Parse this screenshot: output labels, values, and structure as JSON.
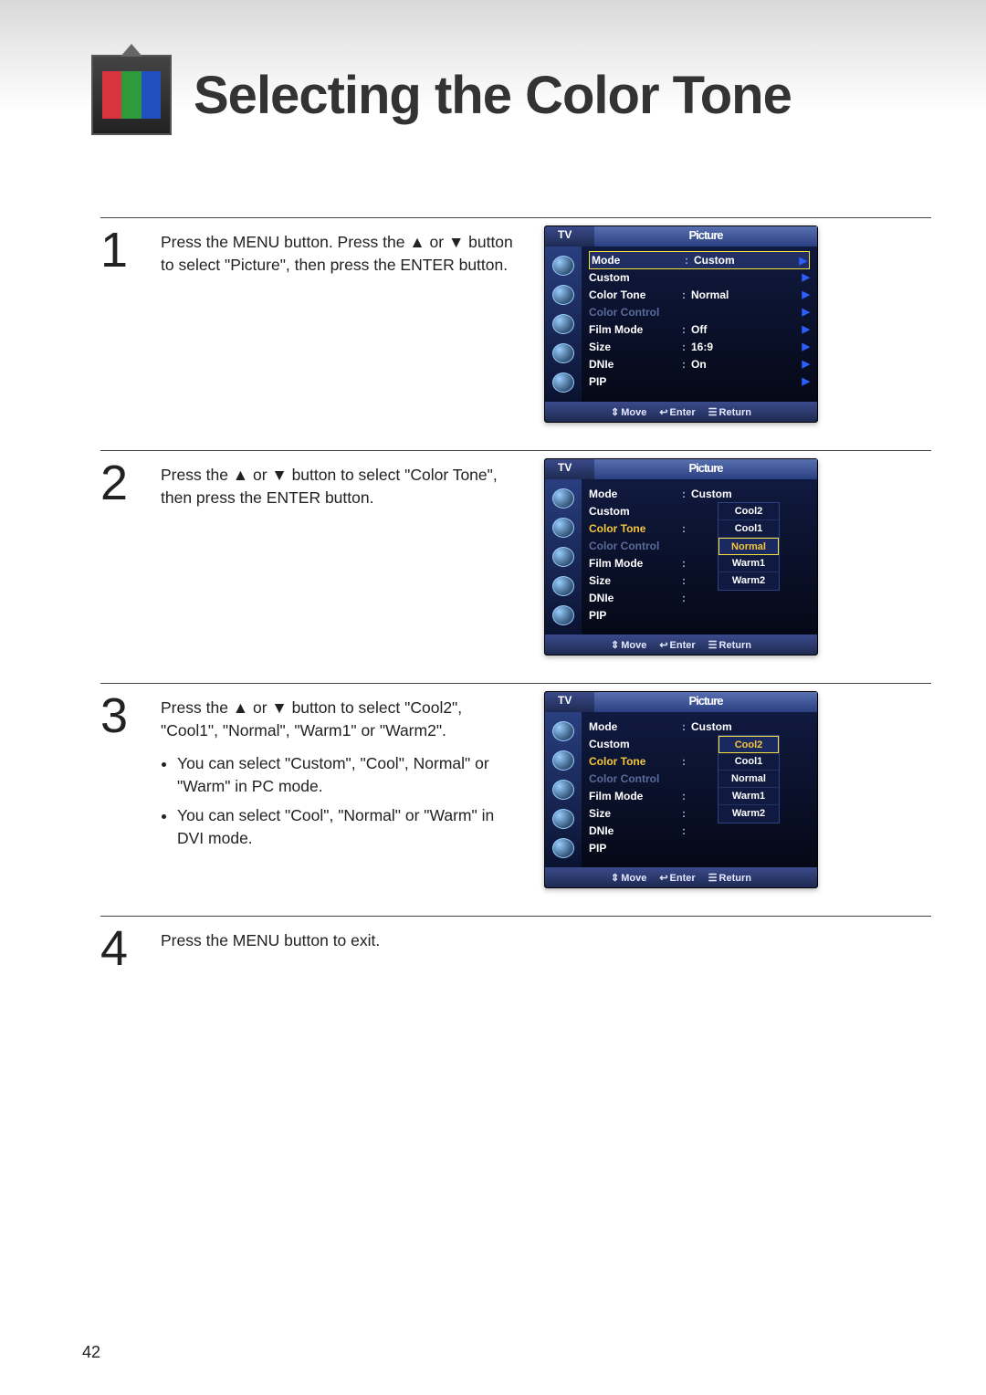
{
  "page_number": "42",
  "title": "Selecting the Color Tone",
  "steps": [
    {
      "num": "1",
      "text": "Press the MENU button. Press the ▲ or ▼ button to select \"Picture\", then press the ENTER button."
    },
    {
      "num": "2",
      "text": "Press the ▲ or ▼ button to select \"Color Tone\", then press the ENTER button."
    },
    {
      "num": "3",
      "text": "Press the ▲ or ▼ button to select \"Cool2\", \"Cool1\", \"Normal\", \"Warm1\" or \"Warm2\".",
      "bullets": [
        "You can select \"Custom\", \"Cool\", Normal\" or \"Warm\" in PC mode.",
        "You can select \"Cool\", \"Normal\" or \"Warm\" in DVI mode."
      ]
    },
    {
      "num": "4",
      "text": "Press the MENU button to exit."
    }
  ],
  "osd_common": {
    "header_left": "TV",
    "header_title": "Picture",
    "footer": {
      "move": "Move",
      "enter": "Enter",
      "return": "Return"
    }
  },
  "osd1": {
    "rows": [
      {
        "label": "Mode",
        "val": "Custom",
        "selected": true
      },
      {
        "label": "Custom"
      },
      {
        "label": "Color Tone",
        "val": "Normal"
      },
      {
        "label": "Color Control",
        "dim": true
      },
      {
        "label": "Film Mode",
        "val": "Off"
      },
      {
        "label": "Size",
        "val": "16:9"
      },
      {
        "label": "DNIe",
        "val": "On"
      },
      {
        "label": "PIP"
      }
    ]
  },
  "osd2": {
    "rows": [
      {
        "label": "Mode",
        "val": "Custom"
      },
      {
        "label": "Custom"
      },
      {
        "label": "Color Tone",
        "highlight": true
      },
      {
        "label": "Color Control",
        "dim": true
      },
      {
        "label": "Film Mode"
      },
      {
        "label": "Size"
      },
      {
        "label": "DNIe"
      },
      {
        "label": "PIP"
      }
    ],
    "dropdown": [
      "Cool2",
      "Cool1",
      "Normal",
      "Warm1",
      "Warm2"
    ],
    "dropdown_selected": "Normal"
  },
  "osd3": {
    "rows": [
      {
        "label": "Mode",
        "val": "Custom"
      },
      {
        "label": "Custom"
      },
      {
        "label": "Color Tone",
        "highlight": true
      },
      {
        "label": "Color Control",
        "dim": true
      },
      {
        "label": "Film Mode"
      },
      {
        "label": "Size"
      },
      {
        "label": "DNIe"
      },
      {
        "label": "PIP"
      }
    ],
    "dropdown": [
      "Cool2",
      "Cool1",
      "Normal",
      "Warm1",
      "Warm2"
    ],
    "dropdown_selected": "Cool2"
  }
}
